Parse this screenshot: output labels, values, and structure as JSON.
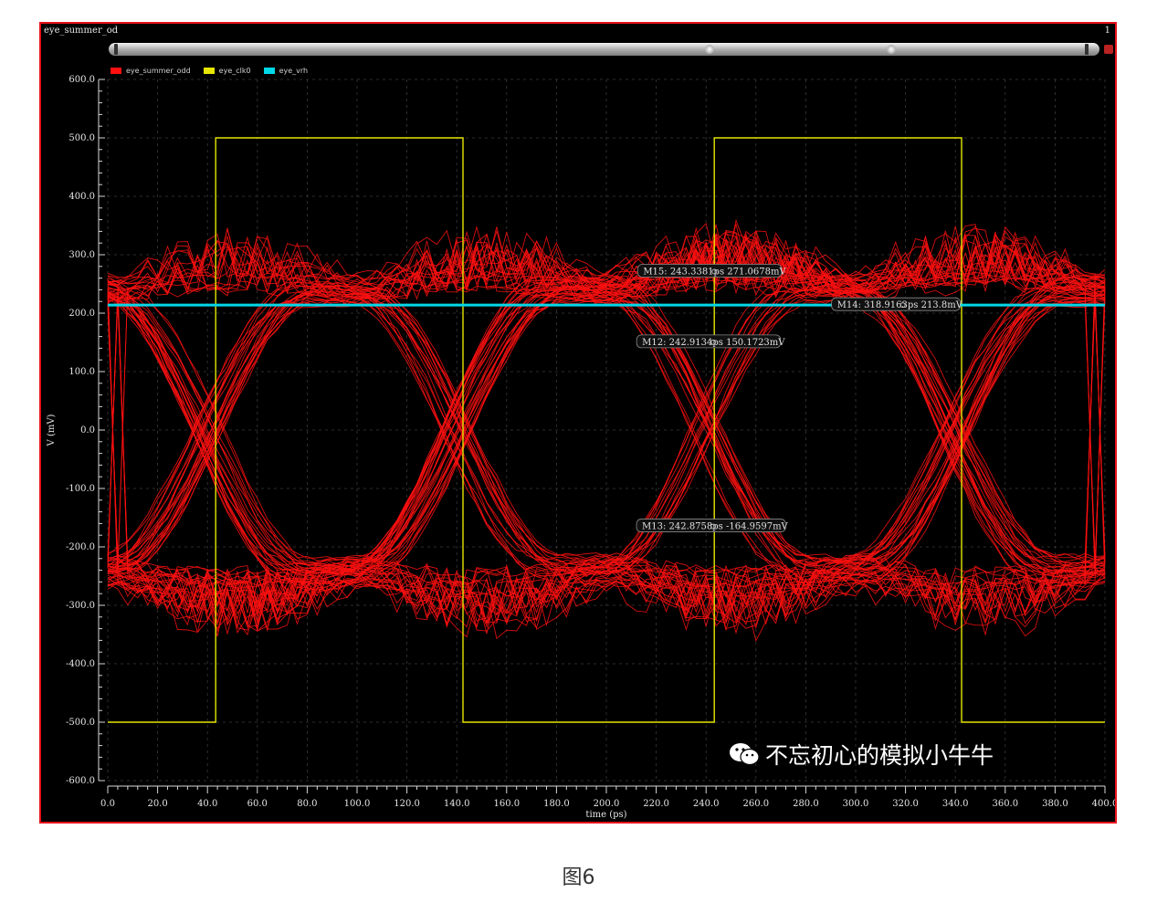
{
  "window": {
    "title": "eye_summer_od",
    "index": "1"
  },
  "caption": "图6",
  "watermark": "不忘初心的模拟小牛牛",
  "colors": {
    "eye_summer_odd": "#ff1010",
    "eye_clk0": "#e6e600",
    "eye_vrh": "#00d8e8",
    "frame": "#e8111b"
  },
  "chart_data": {
    "type": "line",
    "title": "",
    "xlabel": "time (ps)",
    "ylabel": "V (mV)",
    "xlim": [
      0,
      400
    ],
    "ylim": [
      -600,
      600
    ],
    "xticks": [
      "0.0",
      "20.0",
      "40.0",
      "60.0",
      "80.0",
      "100.0",
      "120.0",
      "140.0",
      "160.0",
      "180.0",
      "200.0",
      "220.0",
      "240.0",
      "260.0",
      "280.0",
      "300.0",
      "320.0",
      "340.0",
      "360.0",
      "380.0",
      "400.0"
    ],
    "yticks": [
      "600.0",
      "500.0",
      "400.0",
      "300.0",
      "200.0",
      "100.0",
      "0.0",
      "-100.0",
      "-200.0",
      "-300.0",
      "-400.0",
      "-500.0",
      "-600.0"
    ],
    "grid": true,
    "legend_position": "top-left",
    "series": [
      {
        "name": "eye_summer_odd",
        "kind": "eye diagram",
        "unit_interval_ps": 100,
        "crossings_ps": [
          0,
          100,
          200,
          300,
          400
        ],
        "level_high_mV": [
          215,
          265
        ],
        "level_low_mV": [
          -215,
          -265
        ],
        "overshoot_peak_mV": [
          350,
          -360
        ]
      },
      {
        "name": "eye_clk0",
        "kind": "square wave",
        "x": [
          0,
          43.3,
          43.3,
          142.5,
          142.5,
          243.3,
          243.3,
          342.5,
          342.5,
          400
        ],
        "y": [
          -500,
          -500,
          500,
          500,
          -500,
          -500,
          500,
          500,
          -500,
          -500
        ]
      },
      {
        "name": "eye_vrh",
        "kind": "horizontal line",
        "x": [
          0,
          400
        ],
        "y": [
          213.8,
          213.8
        ]
      }
    ],
    "markers": [
      {
        "label": "M15: 243.3381ps 271.0678mV",
        "x": 243.3381,
        "y": 271.0678
      },
      {
        "label": "M14: 318.9163ps 213.8mV",
        "x": 318.9163,
        "y": 213.8
      },
      {
        "label": "M12: 242.9134ps 150.1723mV",
        "x": 242.9134,
        "y": 150.1723
      },
      {
        "label": "M13: 242.8758ps -164.9597mV",
        "x": 242.8758,
        "y": -164.9597
      }
    ]
  }
}
